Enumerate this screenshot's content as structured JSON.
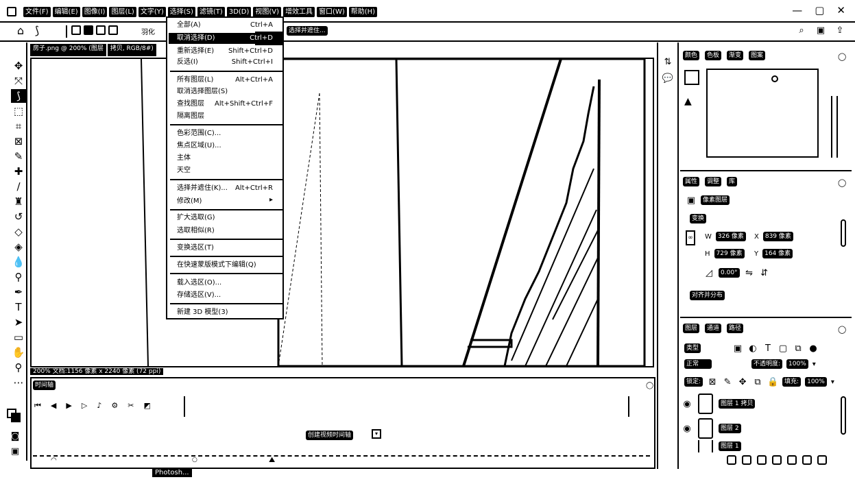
{
  "menubar": {
    "items": [
      "文件(F)",
      "编辑(E)",
      "图像(I)",
      "图层(L)",
      "文字(Y)",
      "选择(S)",
      "滤镜(T)",
      "3D(D)",
      "视图(V)",
      "增效工具",
      "窗口(W)",
      "帮助(H)"
    ],
    "window_controls": [
      "—",
      "▢",
      "✕"
    ]
  },
  "optionsbar": {
    "tool_label": "羽化",
    "select_and_mask": "选择并遮住..."
  },
  "document": {
    "tabs": [
      "房子.png @ 200% (图层",
      "拷贝, RGB/8#)"
    ],
    "status": "200%  文档:1156 像素 x 2240 像素 (72 ppi)"
  },
  "select_menu": {
    "items": [
      {
        "label": "全部(A)",
        "shortcut": "Ctrl+A"
      },
      {
        "label": "取消选择(D)",
        "shortcut": "Ctrl+D",
        "highlighted": true
      },
      {
        "label": "重新选择(E)",
        "shortcut": "Shift+Ctrl+D"
      },
      {
        "label": "反选(I)",
        "shortcut": "Shift+Ctrl+I"
      },
      {
        "label": "所有图层(L)",
        "shortcut": "Alt+Ctrl+A"
      },
      {
        "label": "取消选择图层(S)",
        "shortcut": ""
      },
      {
        "label": "查找图层",
        "shortcut": "Alt+Shift+Ctrl+F"
      },
      {
        "label": "隔离图层",
        "shortcut": ""
      },
      {
        "label": "色彩范围(C)...",
        "shortcut": ""
      },
      {
        "label": "焦点区域(U)...",
        "shortcut": ""
      },
      {
        "label": "主体",
        "shortcut": ""
      },
      {
        "label": "天空",
        "shortcut": ""
      },
      {
        "label": "选择并遮住(K)...",
        "shortcut": "Alt+Ctrl+R"
      },
      {
        "label": "修改(M)",
        "shortcut": "▸"
      },
      {
        "label": "扩大选取(G)",
        "shortcut": ""
      },
      {
        "label": "选取相似(R)",
        "shortcut": ""
      },
      {
        "label": "变换选区(T)",
        "shortcut": ""
      },
      {
        "label": "在快速蒙版模式下编辑(Q)",
        "shortcut": ""
      },
      {
        "label": "载入选区(O)...",
        "shortcut": ""
      },
      {
        "label": "存储选区(V)...",
        "shortcut": ""
      },
      {
        "label": "新建 3D 模型(3)",
        "shortcut": ""
      }
    ]
  },
  "timeline": {
    "tab": "时间轴",
    "create_button": "创建视频时间轴"
  },
  "taskbar": {
    "tooltip": "Photosh..."
  },
  "color_panel": {
    "tabs": [
      "颜色",
      "色板",
      "渐变",
      "图案"
    ]
  },
  "properties_panel": {
    "tabs": [
      "属性",
      "调整",
      "库"
    ],
    "type_label": "像素图层",
    "transform_label": "变换",
    "w": "326 像素",
    "h": "729 像素",
    "x": "839 像素",
    "y": "164 像素",
    "angle": "0.00°",
    "align_label": "对齐并分布"
  },
  "layers_panel": {
    "tabs": [
      "图层",
      "通道",
      "路径"
    ],
    "filter_label": "类型",
    "blend_mode": "正常",
    "opacity_label": "不透明度:",
    "opacity_value": "100%",
    "lock_label": "锁定:",
    "fill_label": "填充:",
    "fill_value": "100%",
    "layers": [
      {
        "name": "图层 1 拷贝"
      },
      {
        "name": "图层 2"
      },
      {
        "name": "图层 1"
      }
    ]
  }
}
